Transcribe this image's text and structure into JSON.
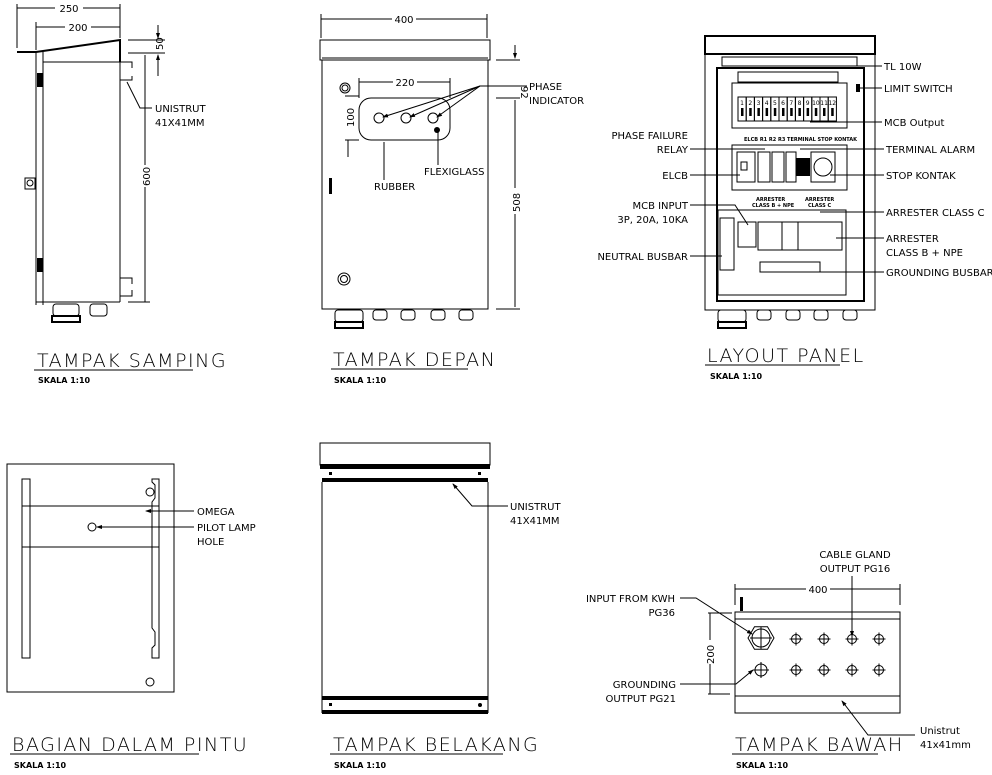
{
  "drawing": {
    "colors": {
      "line": "#000000",
      "background": "#ffffff"
    },
    "views": {
      "side": {
        "title": "TAMPAK SAMPING",
        "scale": "SKALA 1:10",
        "dims": {
          "width_total": "250",
          "width_body": "200",
          "roof": "50",
          "height": "600"
        },
        "labels": {
          "unistrut_1": "UNISTRUT",
          "unistrut_2": "41X41MM"
        }
      },
      "front": {
        "title": "TAMPAK DEPAN",
        "scale": "SKALA 1:10",
        "dims": {
          "width": "400",
          "window_width": "220",
          "window_height": "100",
          "top_offset": "92",
          "body_height": "508"
        },
        "labels": {
          "phase_1": "PHASE",
          "phase_2": "INDICATOR",
          "rubber": "RUBBER",
          "flexiglass": "FLEXIGLASS"
        }
      },
      "layout": {
        "title": "LAYOUT PANEL",
        "scale": "SKALA 1:10",
        "left_labels": {
          "pfr_1": "PHASE FAILURE",
          "pfr_2": "RELAY",
          "elcb": "ELCB",
          "mcb_in_1": "MCB INPUT",
          "mcb_in_2": "3P, 20A, 10KA",
          "neutral": "NEUTRAL BUSBAR"
        },
        "right_labels": {
          "tl": "TL 10W",
          "limit": "LIMIT SWITCH",
          "mcb_out": "MCB Output",
          "term_alarm": "TERMINAL ALARM",
          "stop": "STOP KONTAK",
          "arr_c": "ARRESTER CLASS C",
          "arr_b_1": "ARRESTER",
          "arr_b_2": "CLASS B + NPE",
          "ground": "GROUNDING BUSBAR"
        },
        "inner_labels": {
          "row_header": "ELCB   R1   R2   R3  TERMINAL STOP   KONTAK",
          "arr_b_1": "ARRESTER",
          "arr_b_2": "CLASS B + NPE",
          "arr_c_1": "ARRESTER",
          "arr_c_2": "CLASS C"
        },
        "mcb_numbers": [
          "1",
          "2",
          "3",
          "4",
          "5",
          "6",
          "7",
          "8",
          "9",
          "10",
          "11",
          "12"
        ]
      },
      "door_inside": {
        "title": "BAGIAN DALAM PINTU",
        "scale": "SKALA 1:10",
        "labels": {
          "omega": "OMEGA",
          "pilot_1": "PILOT LAMP",
          "pilot_2": "HOLE"
        }
      },
      "back": {
        "title": "TAMPAK BELAKANG",
        "scale": "SKALA 1:10",
        "labels": {
          "unistrut_1": "UNISTRUT",
          "unistrut_2": "41X41MM"
        }
      },
      "bottom": {
        "title": "TAMPAK BAWAH",
        "scale": "SKALA 1:10",
        "dims": {
          "width": "400",
          "depth": "200"
        },
        "labels": {
          "cable_1": "CABLE GLAND",
          "cable_2": "OUTPUT PG16",
          "input_1": "INPUT FROM KWH",
          "input_2": "PG36",
          "ground_1": "GROUNDING",
          "ground_2": "OUTPUT PG21",
          "unistrut_1": "Unistrut",
          "unistrut_2": "41x41mm"
        }
      }
    }
  }
}
